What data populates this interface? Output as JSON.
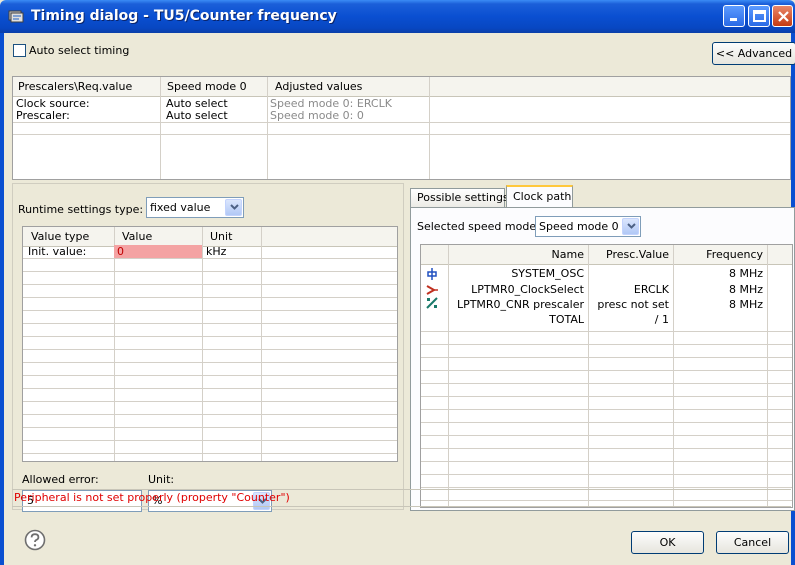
{
  "window": {
    "title": "Timing dialog - TU5/Counter frequency",
    "titlebar_color": "#0a4fd1"
  },
  "auto_select": {
    "label": "Auto select timing",
    "checked": false
  },
  "advanced_button": {
    "label": "<< Advanced"
  },
  "prescaler_table": {
    "headers": [
      "Prescalers\\Req.value",
      "Speed mode 0",
      "Adjusted values"
    ],
    "rows": [
      [
        "Clock source:",
        "Auto select",
        "Speed mode 0: ERCLK"
      ],
      [
        "Prescaler:",
        "Auto select",
        "Speed mode 0: 0"
      ]
    ]
  },
  "runtime": {
    "label": "Runtime settings type:",
    "selected": "fixed value"
  },
  "value_table": {
    "headers": [
      "Value type",
      "Value",
      "Unit"
    ],
    "rows": [
      [
        "Init. value:",
        "0",
        "kHz"
      ]
    ],
    "error_cell_color": "#f4a3a3"
  },
  "allowed_error": {
    "label": "Allowed error:",
    "value": "5"
  },
  "unit": {
    "label": "Unit:",
    "selected": "%"
  },
  "tabs": [
    {
      "label": "Possible settings",
      "active": false
    },
    {
      "label": "Clock path",
      "active": true
    }
  ],
  "speed_mode": {
    "label": "Selected speed mode",
    "selected": "Speed mode 0"
  },
  "clock_table": {
    "headers": [
      "Name",
      "Presc.Value",
      "Frequency"
    ],
    "rows": [
      {
        "icon": "oscillator-icon",
        "name": "SYSTEM_OSC",
        "presc": "",
        "freq": "8 MHz"
      },
      {
        "icon": "clock-select-icon",
        "name": "LPTMR0_ClockSelect",
        "presc": "ERCLK",
        "freq": "8 MHz"
      },
      {
        "icon": "prescaler-icon",
        "name": "LPTMR0_CNR prescaler",
        "presc": "presc not set",
        "freq": "8 MHz"
      },
      {
        "icon": "",
        "name": "TOTAL",
        "presc": "/ 1",
        "freq": ""
      }
    ]
  },
  "status": {
    "message": "Peripheral is not set properly (property \"Counter\")",
    "color": "#e00000"
  },
  "buttons": {
    "ok": "OK",
    "cancel": "Cancel"
  }
}
